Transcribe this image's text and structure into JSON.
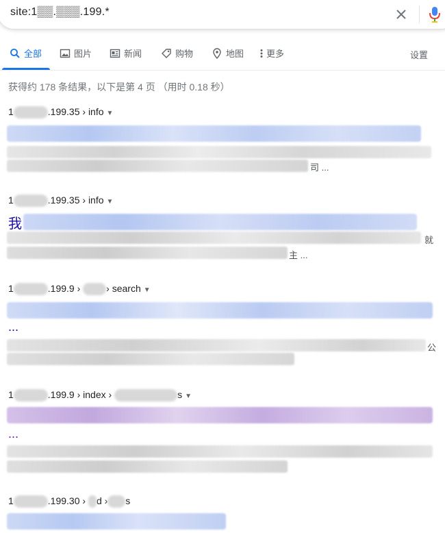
{
  "search": {
    "query": "site:1▒▒.▒▒▒.199.*"
  },
  "tabs": [
    {
      "label": "全部",
      "icon": "search-icon"
    },
    {
      "label": "图片",
      "icon": "image-icon"
    },
    {
      "label": "新闻",
      "icon": "news-icon"
    },
    {
      "label": "购物",
      "icon": "shopping-tag-icon"
    },
    {
      "label": "地图",
      "icon": "map-pin-icon"
    },
    {
      "label": "更多",
      "icon": "more-vert-icon"
    }
  ],
  "settings_label": "设置",
  "stats": "获得约 178 条结果，以下是第 4 页 （用时 0.18 秒）",
  "results": [
    {
      "cite_pre": "1",
      "cite_post": ".199.35 › info",
      "snippet_tail": "司 ..."
    },
    {
      "cite_pre": "1",
      "cite_post": ".199.35 › info",
      "title_lead": "我",
      "snippet_right": "就",
      "snippet_tail": "主 ..."
    },
    {
      "cite_pre": "1",
      "cite_post": ".199.9 › ",
      "cite_tail": "› search",
      "ellipsis": "...",
      "snippet_right": "公"
    },
    {
      "cite_pre": "1",
      "cite_post": ".199.9 › index › ",
      "cite_tail": "s",
      "ellipsis": "..."
    },
    {
      "cite_pre": "1",
      "cite_post": ".199.30 › ",
      "cite_tail": "d ›",
      "cite_end": "s"
    }
  ],
  "colors": {
    "accent": "#1a73e8",
    "link": "#1a0dab",
    "visited": "#681da8"
  }
}
